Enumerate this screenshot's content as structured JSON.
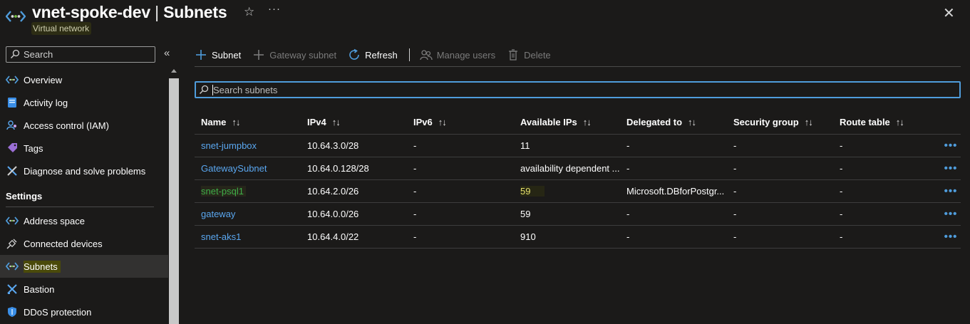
{
  "header": {
    "resource_name": "vnet-spoke-dev",
    "separator": "|",
    "page_name": "Subnets",
    "resource_type": "Virtual network",
    "favorite_icon": "star-icon",
    "more_icon": "ellipsis-icon",
    "more_label": "···",
    "close_label": "✕"
  },
  "sidebar": {
    "search_placeholder": "Search",
    "collapse_label": "«",
    "items": [
      {
        "label": "Overview",
        "icon": "vnet-icon"
      },
      {
        "label": "Activity log",
        "icon": "activity-log-icon"
      },
      {
        "label": "Access control (IAM)",
        "icon": "iam-icon"
      },
      {
        "label": "Tags",
        "icon": "tag-icon"
      },
      {
        "label": "Diagnose and solve problems",
        "icon": "wrench-icon"
      }
    ],
    "section": "Settings",
    "settings_items": [
      {
        "label": "Address space",
        "icon": "vnet-icon"
      },
      {
        "label": "Connected devices",
        "icon": "plug-icon"
      },
      {
        "label": "Subnets",
        "icon": "vnet-icon",
        "active": true
      },
      {
        "label": "Bastion",
        "icon": "bastion-icon"
      },
      {
        "label": "DDoS protection",
        "icon": "shield-icon"
      }
    ]
  },
  "toolbar": {
    "subnet": "Subnet",
    "gateway_subnet": "Gateway subnet",
    "refresh": "Refresh",
    "manage_users": "Manage users",
    "delete": "Delete"
  },
  "search": {
    "placeholder": "Search subnets"
  },
  "table": {
    "sort_glyph": "↑↓",
    "columns": [
      "Name",
      "IPv4",
      "IPv6",
      "Available IPs",
      "Delegated to",
      "Security group",
      "Route table"
    ],
    "rows": [
      {
        "name": "snet-jumpbox",
        "ipv4": "10.64.3.0/28",
        "ipv6": "-",
        "available": "11",
        "delegated": "-",
        "nsg": "-",
        "route": "-",
        "more": "•••"
      },
      {
        "name": "GatewaySubnet",
        "ipv4": "10.64.0.128/28",
        "ipv6": "-",
        "available": "availability dependent ...",
        "delegated": "-",
        "nsg": "-",
        "route": "-",
        "more": "•••"
      },
      {
        "name": "snet-psql1",
        "ipv4": "10.64.2.0/26",
        "ipv6": "-",
        "available": "59",
        "delegated": "Microsoft.DBforPostgr...",
        "nsg": "-",
        "route": "-",
        "more": "•••"
      },
      {
        "name": "gateway",
        "ipv4": "10.64.0.0/26",
        "ipv6": "-",
        "available": "59",
        "delegated": "-",
        "nsg": "-",
        "route": "-",
        "more": "•••"
      },
      {
        "name": "snet-aks1",
        "ipv4": "10.64.4.0/22",
        "ipv6": "-",
        "available": "910",
        "delegated": "-",
        "nsg": "-",
        "route": "-",
        "more": "•••"
      }
    ]
  },
  "colors": {
    "accent": "#4f9cdb",
    "link": "#5aa7f0",
    "background": "#1b1a19",
    "highlight_yellow": "#e5e06a",
    "highlight_green": "#3fae49"
  }
}
